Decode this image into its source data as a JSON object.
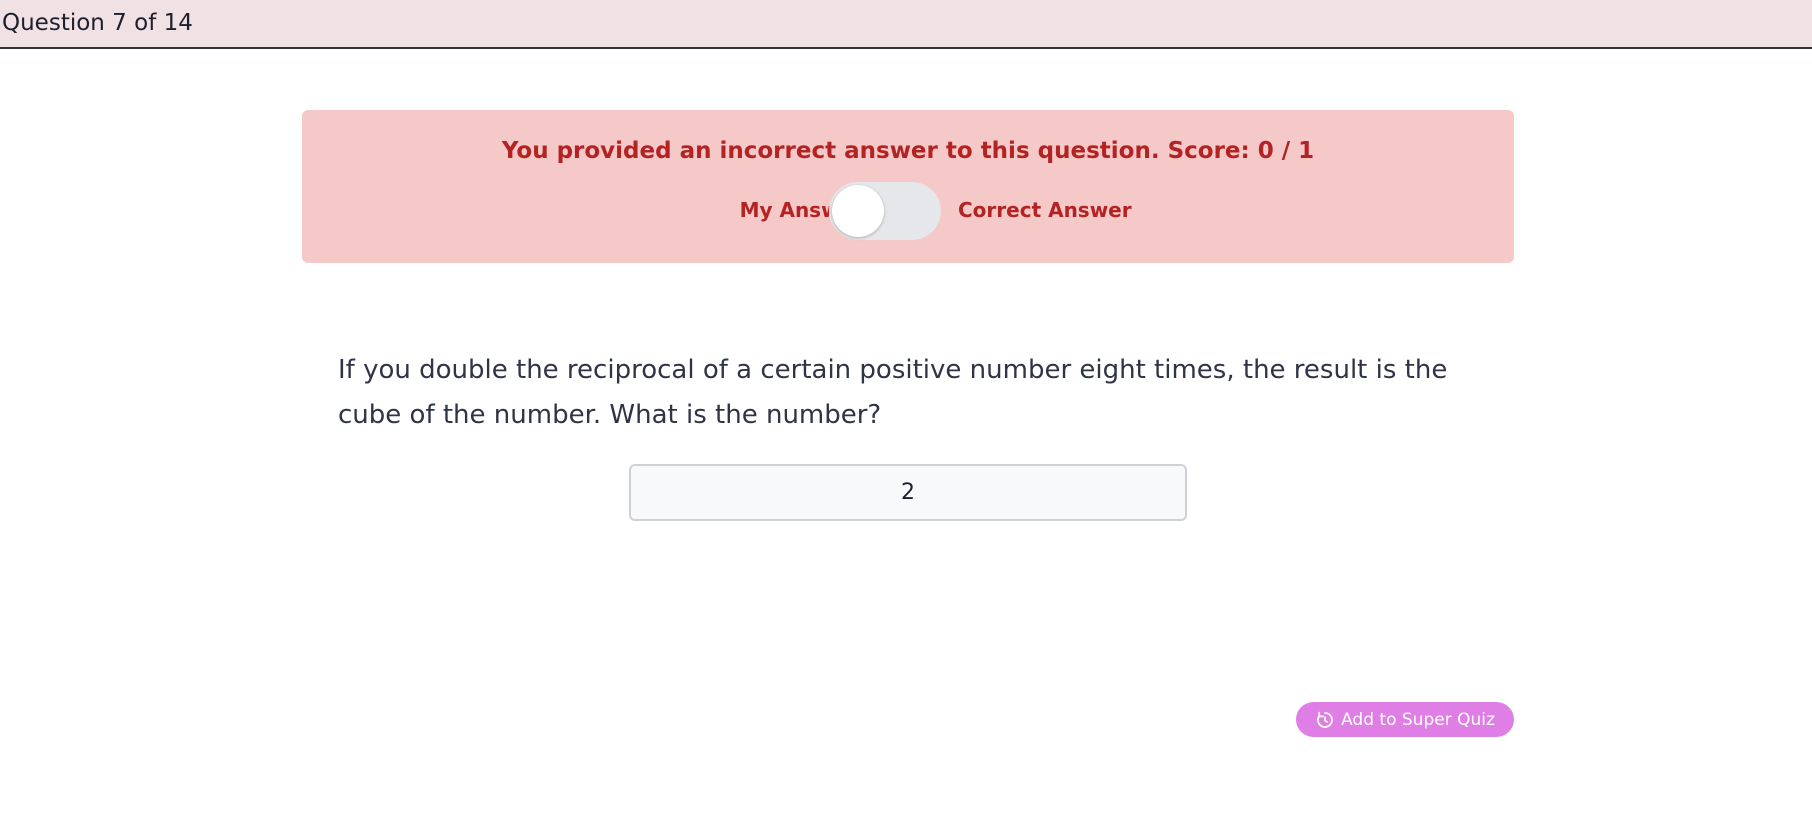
{
  "header": {
    "title": "Question 7 of 14"
  },
  "feedback": {
    "message": "You provided an incorrect answer to this question. Score: 0 / 1",
    "toggle": {
      "left_label": "My Answer",
      "right_label": "Correct Answer",
      "state": "my-answer"
    },
    "colors": {
      "background": "#f5c9c8",
      "text": "#b42323"
    }
  },
  "question": {
    "text": "If you double the reciprocal of a certain positive number eight times, the result is the cube of the number. What is the number?"
  },
  "answer": {
    "value": "2"
  },
  "actions": {
    "super_quiz_label": "Add to Super Quiz",
    "super_quiz_icon": "refresh-circle-icon",
    "super_quiz_color": "#df7fe6"
  }
}
